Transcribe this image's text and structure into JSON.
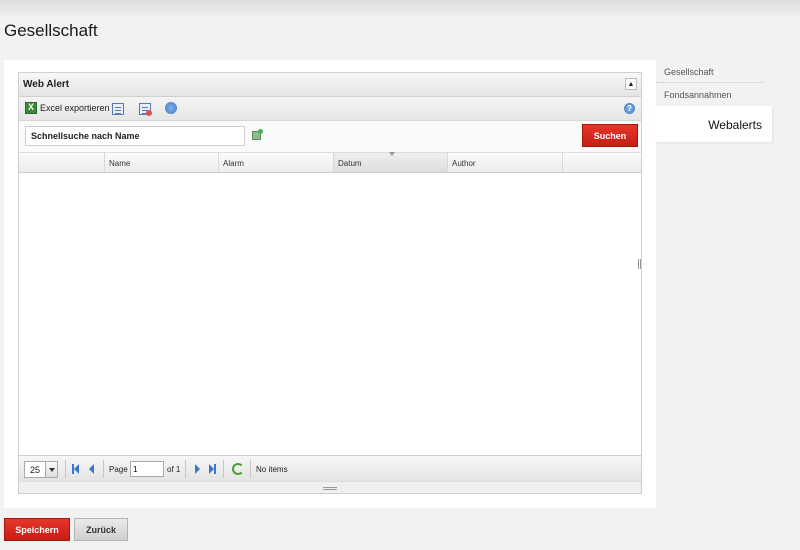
{
  "page": {
    "title": "Gesellschaft"
  },
  "grid": {
    "title": "Web Alert",
    "toolbar": {
      "excel_label": "Excel exportieren"
    },
    "search": {
      "value": "Schnellsuche nach Name",
      "button_label": "Suchen"
    },
    "columns": [
      "",
      "Name",
      "Alarm",
      "Datum",
      "Author"
    ],
    "rows": [],
    "pager": {
      "page_size": "25",
      "page_label": "Page",
      "page_value": "1",
      "of_label": "of 1",
      "status": "No items"
    }
  },
  "side_nav": {
    "items": [
      {
        "label": "Gesellschaft"
      },
      {
        "label": "Fondsannahmen"
      },
      {
        "label": "Webalerts"
      }
    ]
  },
  "footer": {
    "save_label": "Speichern",
    "back_label": "Zurück"
  }
}
